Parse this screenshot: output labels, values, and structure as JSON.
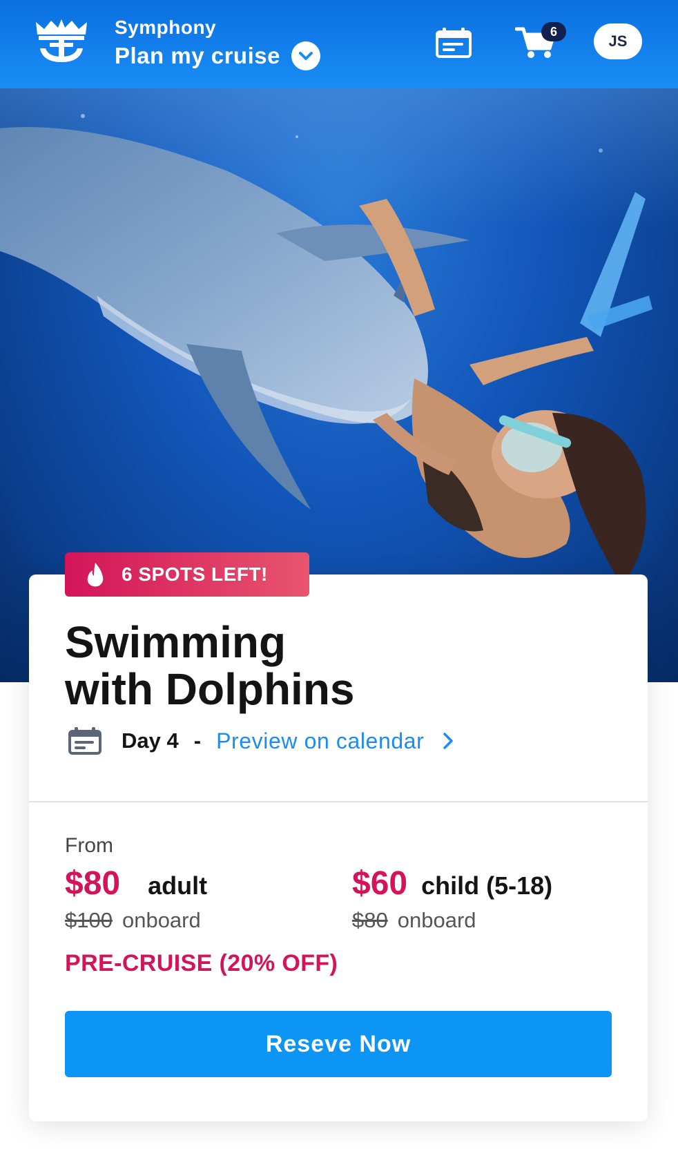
{
  "header": {
    "ship_name": "Symphony",
    "plan_title": "Plan my cruise",
    "cart_count": "6",
    "avatar_initials": "JS"
  },
  "carousel": {
    "slide_count": 4,
    "active_index": 0
  },
  "activity": {
    "badge_text": "6 SPOTS LEFT!",
    "title_line1": "Swimming",
    "title_line2": "with Dolphins",
    "day_label": "Day 4",
    "separator": "-",
    "preview_link": "Preview on calendar"
  },
  "pricing": {
    "from_label": "From",
    "adult": {
      "price": "$80",
      "label": "adult",
      "old_price": "$100",
      "onboard": "onboard"
    },
    "child": {
      "price": "$60",
      "label": "child (5-18)",
      "old_price": "$80",
      "onboard": "onboard"
    },
    "promo": "PRE-CRUISE (20% OFF)"
  },
  "cta": {
    "reserve_label": "Reseve Now"
  },
  "colors": {
    "header_blue": "#1a8df5",
    "accent_pink": "#d4145a",
    "button_blue": "#0d95f5",
    "link_blue": "#1a8df5"
  },
  "icons": {
    "logo": "crown-anchor-logo-icon",
    "calendar": "calendar-icon",
    "cart": "shopping-cart-icon",
    "dropdown": "chevron-down-icon",
    "badge": "flame-icon",
    "link": "chevron-right-icon"
  }
}
